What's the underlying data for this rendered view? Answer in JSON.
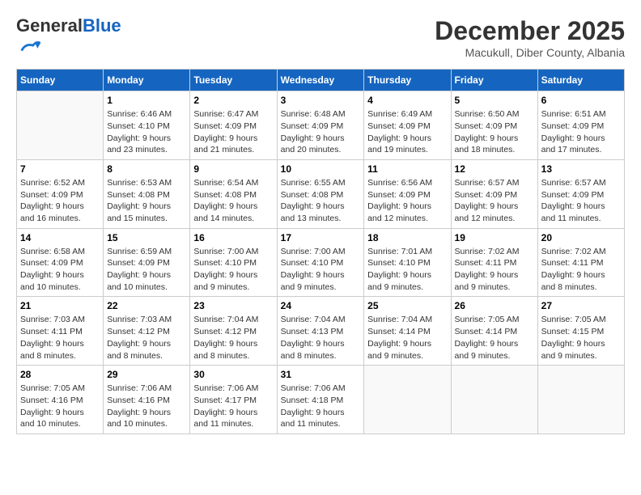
{
  "logo": {
    "general": "General",
    "blue": "Blue"
  },
  "header": {
    "month": "December 2025",
    "location": "Macukull, Diber County, Albania"
  },
  "days_of_week": [
    "Sunday",
    "Monday",
    "Tuesday",
    "Wednesday",
    "Thursday",
    "Friday",
    "Saturday"
  ],
  "weeks": [
    [
      {
        "day": "",
        "info": ""
      },
      {
        "day": "1",
        "info": "Sunrise: 6:46 AM\nSunset: 4:10 PM\nDaylight: 9 hours\nand 23 minutes."
      },
      {
        "day": "2",
        "info": "Sunrise: 6:47 AM\nSunset: 4:09 PM\nDaylight: 9 hours\nand 21 minutes."
      },
      {
        "day": "3",
        "info": "Sunrise: 6:48 AM\nSunset: 4:09 PM\nDaylight: 9 hours\nand 20 minutes."
      },
      {
        "day": "4",
        "info": "Sunrise: 6:49 AM\nSunset: 4:09 PM\nDaylight: 9 hours\nand 19 minutes."
      },
      {
        "day": "5",
        "info": "Sunrise: 6:50 AM\nSunset: 4:09 PM\nDaylight: 9 hours\nand 18 minutes."
      },
      {
        "day": "6",
        "info": "Sunrise: 6:51 AM\nSunset: 4:09 PM\nDaylight: 9 hours\nand 17 minutes."
      }
    ],
    [
      {
        "day": "7",
        "info": "Sunrise: 6:52 AM\nSunset: 4:09 PM\nDaylight: 9 hours\nand 16 minutes."
      },
      {
        "day": "8",
        "info": "Sunrise: 6:53 AM\nSunset: 4:08 PM\nDaylight: 9 hours\nand 15 minutes."
      },
      {
        "day": "9",
        "info": "Sunrise: 6:54 AM\nSunset: 4:08 PM\nDaylight: 9 hours\nand 14 minutes."
      },
      {
        "day": "10",
        "info": "Sunrise: 6:55 AM\nSunset: 4:08 PM\nDaylight: 9 hours\nand 13 minutes."
      },
      {
        "day": "11",
        "info": "Sunrise: 6:56 AM\nSunset: 4:09 PM\nDaylight: 9 hours\nand 12 minutes."
      },
      {
        "day": "12",
        "info": "Sunrise: 6:57 AM\nSunset: 4:09 PM\nDaylight: 9 hours\nand 12 minutes."
      },
      {
        "day": "13",
        "info": "Sunrise: 6:57 AM\nSunset: 4:09 PM\nDaylight: 9 hours\nand 11 minutes."
      }
    ],
    [
      {
        "day": "14",
        "info": "Sunrise: 6:58 AM\nSunset: 4:09 PM\nDaylight: 9 hours\nand 10 minutes."
      },
      {
        "day": "15",
        "info": "Sunrise: 6:59 AM\nSunset: 4:09 PM\nDaylight: 9 hours\nand 10 minutes."
      },
      {
        "day": "16",
        "info": "Sunrise: 7:00 AM\nSunset: 4:10 PM\nDaylight: 9 hours\nand 9 minutes."
      },
      {
        "day": "17",
        "info": "Sunrise: 7:00 AM\nSunset: 4:10 PM\nDaylight: 9 hours\nand 9 minutes."
      },
      {
        "day": "18",
        "info": "Sunrise: 7:01 AM\nSunset: 4:10 PM\nDaylight: 9 hours\nand 9 minutes."
      },
      {
        "day": "19",
        "info": "Sunrise: 7:02 AM\nSunset: 4:11 PM\nDaylight: 9 hours\nand 9 minutes."
      },
      {
        "day": "20",
        "info": "Sunrise: 7:02 AM\nSunset: 4:11 PM\nDaylight: 9 hours\nand 8 minutes."
      }
    ],
    [
      {
        "day": "21",
        "info": "Sunrise: 7:03 AM\nSunset: 4:11 PM\nDaylight: 9 hours\nand 8 minutes."
      },
      {
        "day": "22",
        "info": "Sunrise: 7:03 AM\nSunset: 4:12 PM\nDaylight: 9 hours\nand 8 minutes."
      },
      {
        "day": "23",
        "info": "Sunrise: 7:04 AM\nSunset: 4:12 PM\nDaylight: 9 hours\nand 8 minutes."
      },
      {
        "day": "24",
        "info": "Sunrise: 7:04 AM\nSunset: 4:13 PM\nDaylight: 9 hours\nand 8 minutes."
      },
      {
        "day": "25",
        "info": "Sunrise: 7:04 AM\nSunset: 4:14 PM\nDaylight: 9 hours\nand 9 minutes."
      },
      {
        "day": "26",
        "info": "Sunrise: 7:05 AM\nSunset: 4:14 PM\nDaylight: 9 hours\nand 9 minutes."
      },
      {
        "day": "27",
        "info": "Sunrise: 7:05 AM\nSunset: 4:15 PM\nDaylight: 9 hours\nand 9 minutes."
      }
    ],
    [
      {
        "day": "28",
        "info": "Sunrise: 7:05 AM\nSunset: 4:16 PM\nDaylight: 9 hours\nand 10 minutes."
      },
      {
        "day": "29",
        "info": "Sunrise: 7:06 AM\nSunset: 4:16 PM\nDaylight: 9 hours\nand 10 minutes."
      },
      {
        "day": "30",
        "info": "Sunrise: 7:06 AM\nSunset: 4:17 PM\nDaylight: 9 hours\nand 11 minutes."
      },
      {
        "day": "31",
        "info": "Sunrise: 7:06 AM\nSunset: 4:18 PM\nDaylight: 9 hours\nand 11 minutes."
      },
      {
        "day": "",
        "info": ""
      },
      {
        "day": "",
        "info": ""
      },
      {
        "day": "",
        "info": ""
      }
    ]
  ]
}
